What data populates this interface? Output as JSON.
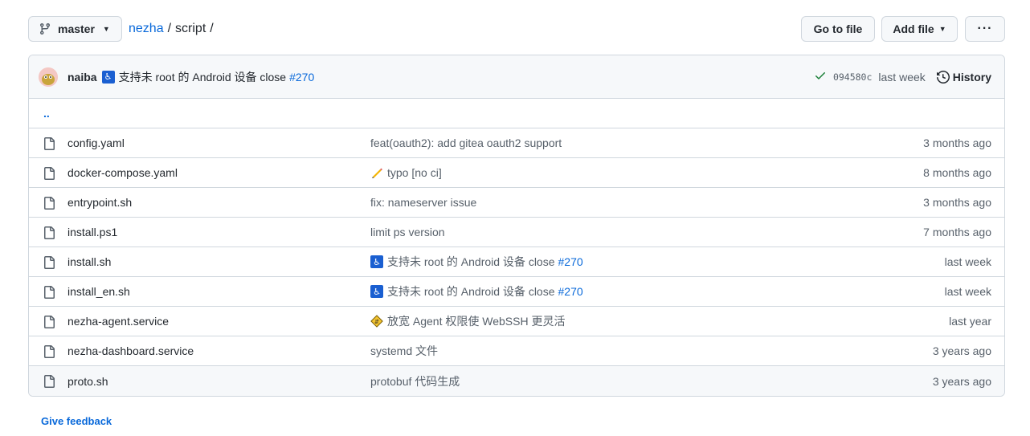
{
  "branch": {
    "name": "master"
  },
  "breadcrumb": {
    "repo": "nezha",
    "sep1": "/",
    "folder": "script",
    "sep2": "/"
  },
  "buttons": {
    "go_to_file": "Go to file",
    "add_file": "Add file",
    "more": "···"
  },
  "latest_commit": {
    "author": "naiba",
    "message": "支持未 root 的 Android 设备 close",
    "issue": "#270",
    "sha": "094580c",
    "when": "last week",
    "history_label": "History"
  },
  "updir": "..",
  "files": [
    {
      "name": "config.yaml",
      "message": "feat(oauth2): add gitea oauth2 support",
      "issue": "",
      "emoji": "",
      "date": "3 months ago"
    },
    {
      "name": "docker-compose.yaml",
      "message": "typo [no ci]",
      "issue": "",
      "emoji": "pencil-icon",
      "date": "8 months ago"
    },
    {
      "name": "entrypoint.sh",
      "message": "fix: nameserver issue",
      "issue": "",
      "emoji": "",
      "date": "3 months ago"
    },
    {
      "name": "install.ps1",
      "message": "limit ps version",
      "issue": "",
      "emoji": "",
      "date": "7 months ago"
    },
    {
      "name": "install.sh",
      "message": "支持未 root 的 Android 设备 close",
      "issue": "#270",
      "emoji": "wheelchair-icon",
      "date": "last week"
    },
    {
      "name": "install_en.sh",
      "message": "支持未 root 的 Android 设备 close",
      "issue": "#270",
      "emoji": "wheelchair-icon",
      "date": "last week"
    },
    {
      "name": "nezha-agent.service",
      "message": "放宽 Agent 权限使 WebSSH 更灵活",
      "issue": "",
      "emoji": "passport-control-icon",
      "date": "last year"
    },
    {
      "name": "nezha-dashboard.service",
      "message": "systemd 文件",
      "issue": "",
      "emoji": "",
      "date": "3 years ago"
    },
    {
      "name": "proto.sh",
      "message": "protobuf 代码生成",
      "issue": "",
      "emoji": "",
      "date": "3 years ago"
    }
  ],
  "feedback": "Give feedback",
  "colors": {
    "link": "#0969da",
    "success": "#1a7f37",
    "border": "#d0d7de",
    "header_bg": "#f6f8fa"
  }
}
